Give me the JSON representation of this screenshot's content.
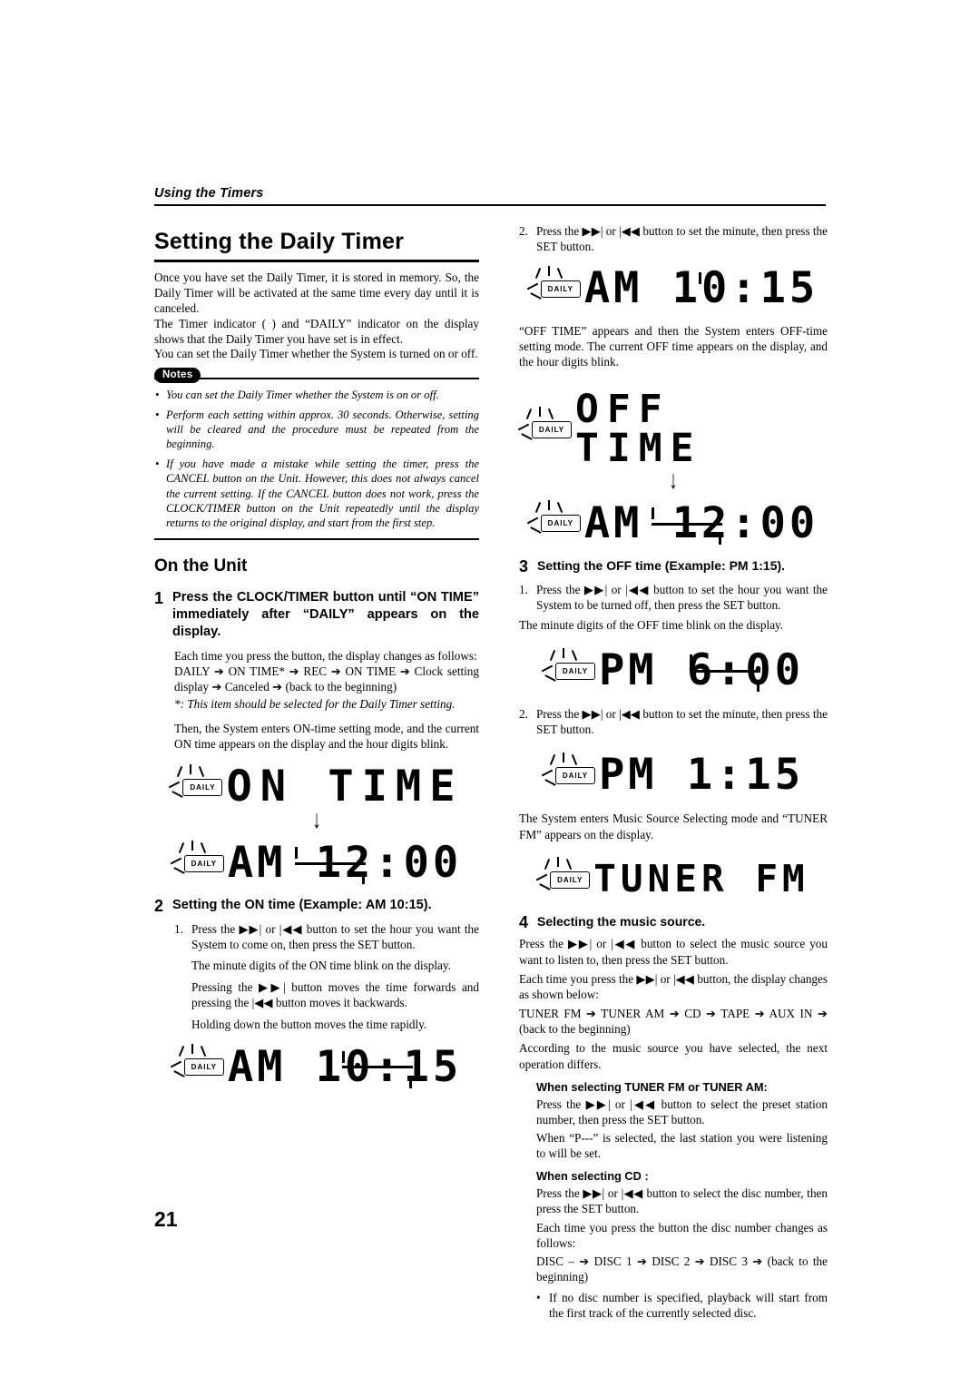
{
  "running_head": "Using the Timers",
  "page_number": "21",
  "left": {
    "title": "Setting the Daily Timer",
    "intro1": "Once you have set the Daily Timer, it is stored in memory. So, the Daily Timer will be activated at the same time every day until it is canceled.",
    "intro2": "The Timer indicator (   ) and “DAILY” indicator on the display shows that the Daily Timer you have set is in effect.",
    "intro3": "You can set the Daily Timer whether the System is turned on or off.",
    "notes_label": "Notes",
    "notes": [
      "You can set the Daily Timer whether the System is on or off.",
      "Perform each setting within approx. 30 seconds. Otherwise, setting will be cleared and the procedure must be repeated from the beginning.",
      "If you have made a mistake while setting the timer, press the CANCEL button on the Unit. However, this does not always cancel the current setting. If the CANCEL button does not work, press the CLOCK/TIMER button on the Unit repeatedly until the display returns to the original display, and start from the first step."
    ],
    "on_the_unit": "On the Unit",
    "step1": {
      "num": "1",
      "heading": "Press the CLOCK/TIMER button until “ON TIME” immediately after “DAILY” appears on the display.",
      "body1": "Each time you press the button, the display changes as follows:",
      "body2": "DAILY ➔ ON TIME* ➔ REC ➔ ON TIME ➔ Clock setting display ➔ Canceled ➔ (back to the beginning)",
      "footnote": "*: This item should be selected for the Daily Timer setting.",
      "body3": "Then, the System enters ON-time setting mode, and the current ON time appears on the display and the hour digits blink."
    },
    "lcd_on_time": {
      "daily": "DAILY",
      "text": "ON TIME"
    },
    "lcd_am1200": {
      "daily": "DAILY",
      "text": "AM 12:00"
    },
    "step2": {
      "num": "2",
      "heading": "Setting the ON time (Example: AM 10:15).",
      "items": [
        "Press the ▶▶| or |◀◀ button to set the hour you want the System to come on, then press the SET button."
      ],
      "body1": "The minute digits of the ON time blink on the display.",
      "body2": "Pressing the ▶▶| button moves the time forwards and pressing the |◀◀ button moves it backwards.",
      "body3": "Holding down the button moves the time rapidly."
    },
    "lcd_am1015_blink": {
      "daily": "DAILY",
      "text": "AM 10:15"
    }
  },
  "right": {
    "top_item": {
      "num": "2.",
      "text": "Press the ▶▶| or |◀◀ button to set the minute, then press the SET button."
    },
    "lcd_am1015": {
      "daily": "DAILY",
      "text": "AM 10:15"
    },
    "para1": "“OFF TIME” appears and then the System enters OFF-time setting mode. The current OFF time appears on the display, and the hour digits blink.",
    "lcd_off_time": {
      "daily": "DAILY",
      "text": "OFF TIME"
    },
    "lcd_am1200": {
      "daily": "DAILY",
      "text": "AM 12:00"
    },
    "step3": {
      "num": "3",
      "heading": "Setting the OFF time (Example: PM 1:15).",
      "item1_num": "1.",
      "item1": "Press the ▶▶| or |◀◀ button to set the hour you want the System to be turned off, then press the SET button.",
      "body1": "The minute digits of the OFF time blink on the display.",
      "item2_num": "2.",
      "item2": "Press the ▶▶| or |◀◀ button to set the minute, then press the SET button."
    },
    "lcd_pm600": {
      "daily": "DAILY",
      "text": "PM 6:00"
    },
    "lcd_pm115": {
      "daily": "DAILY",
      "text": "PM 1:15"
    },
    "para2": "The System enters Music Source Selecting mode and “TUNER FM” appears on the display.",
    "lcd_tuner_fm": {
      "daily": "DAILY",
      "text": "TUNER FM"
    },
    "step4": {
      "num": "4",
      "heading": "Selecting the music source.",
      "body1": "Press the ▶▶| or |◀◀ button to select the music source you want to listen to, then press the SET button.",
      "body2": "Each time you press the ▶▶| or |◀◀ button, the display changes as shown below:",
      "body3": "TUNER FM ➔ TUNER AM ➔ CD ➔ TAPE ➔ AUX IN ➔ (back to the beginning)",
      "body4": "According to the music source you have selected, the next operation differs.",
      "sub1_head": "When selecting TUNER FM or TUNER AM:",
      "sub1_body1": "Press the ▶▶| or |◀◀ button to select the preset station number, then press the SET button.",
      "sub1_body2": "When “P---” is selected, the last station you were listening to will be set.",
      "sub2_head": "When selecting CD :",
      "sub2_body1": "Press the ▶▶| or |◀◀ button to select the disc number, then press the SET button.",
      "sub2_body2": "Each time you press the button the disc number changes as follows:",
      "sub2_body3": "DISC – ➔ DISC 1 ➔ DISC 2 ➔ DISC 3 ➔ (back to the beginning)",
      "bullet": "If no disc number is specified, playback will start from the first track of the currently selected disc."
    }
  }
}
